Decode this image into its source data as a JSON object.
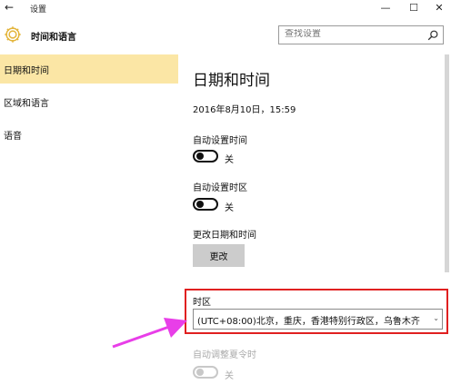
{
  "window": {
    "title": "设置",
    "back_icon": "←",
    "minimize_icon": "—",
    "maximize_icon": "☐",
    "close_icon": "✕"
  },
  "header": {
    "section_title": "时间和语言",
    "search_placeholder": "查找设置"
  },
  "sidebar": {
    "items": [
      {
        "label": "日期和时间",
        "active": true
      },
      {
        "label": "区域和语言",
        "active": false
      },
      {
        "label": "语音",
        "active": false
      }
    ]
  },
  "main": {
    "title": "日期和时间",
    "current_datetime": "2016年8月10日，15:59",
    "auto_time": {
      "label": "自动设置时间",
      "state": "关"
    },
    "auto_timezone": {
      "label": "自动设置时区",
      "state": "关"
    },
    "change_datetime": {
      "label": "更改日期和时间",
      "button": "更改"
    },
    "timezone": {
      "label": "时区",
      "value": "(UTC+08:00)北京，重庆，香港特别行政区，乌鲁木齐"
    },
    "dst": {
      "label": "自动调整夏令时",
      "state": "关"
    }
  },
  "colors": {
    "active_nav": "#fbe6a5",
    "highlight_box": "#e02020",
    "annotation_arrow": "#e83ee8"
  }
}
